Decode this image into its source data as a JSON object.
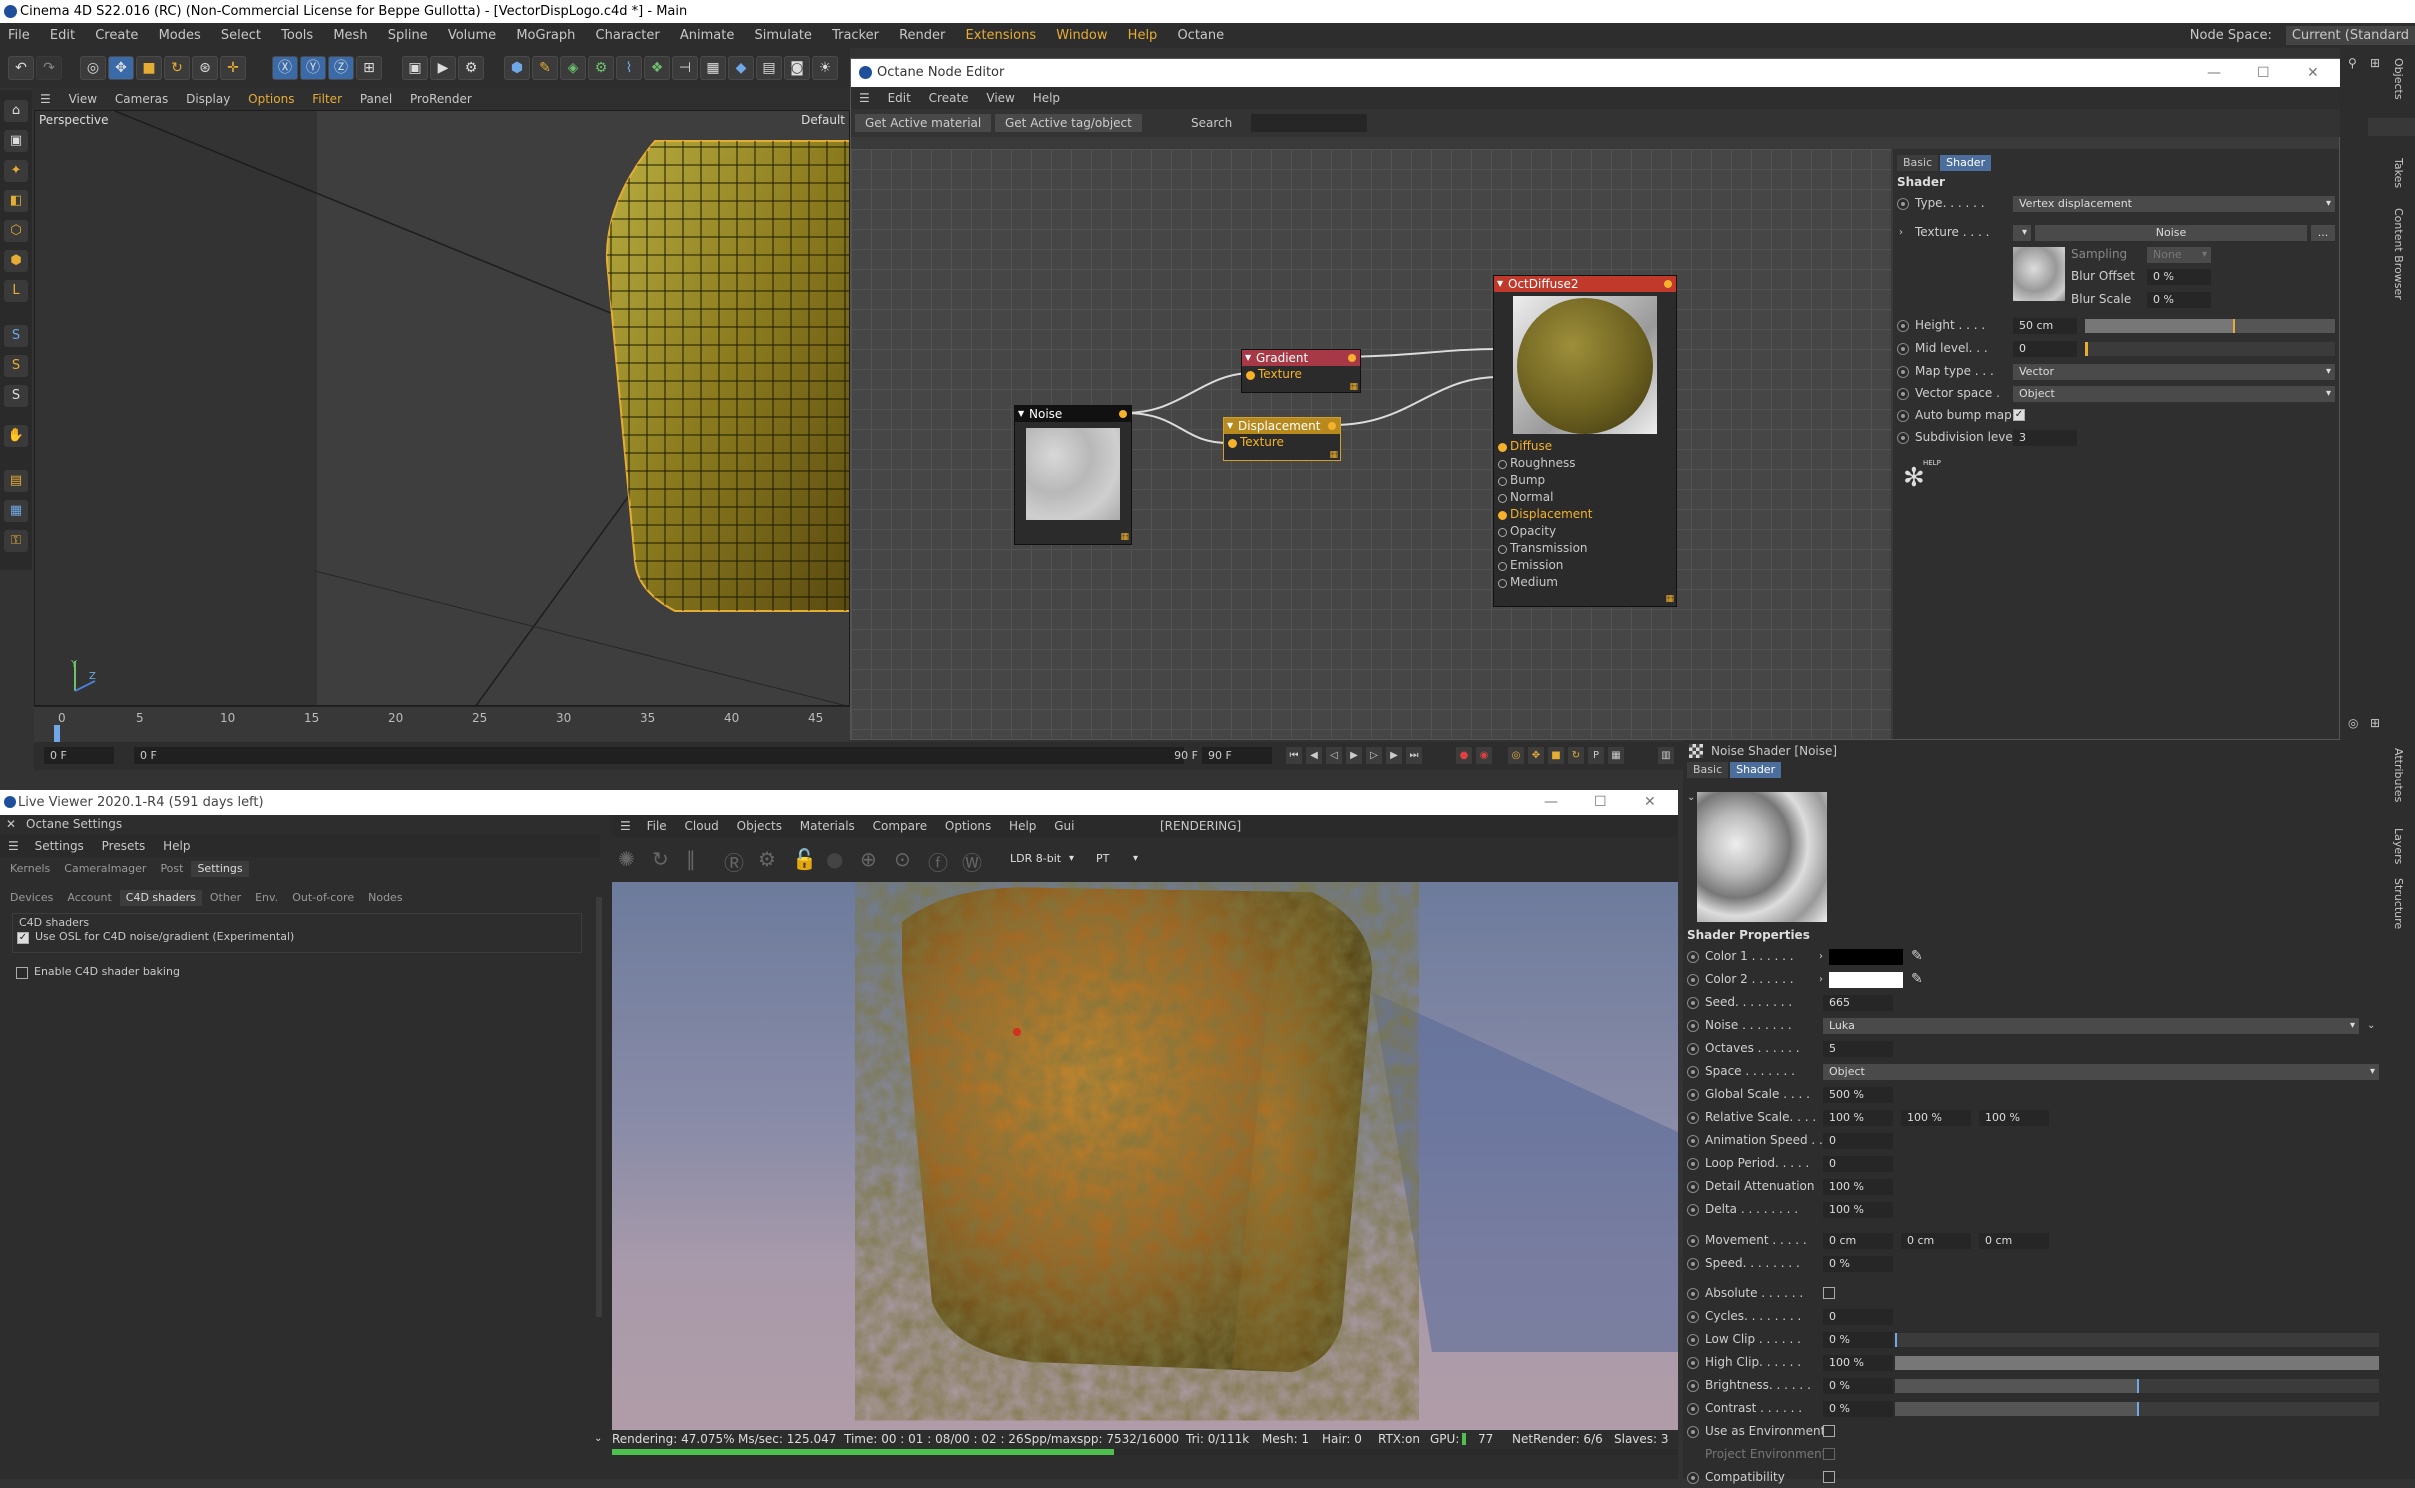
{
  "window": {
    "title": "Cinema 4D S22.016 (RC) (Non-Commercial License for Beppe Gullotta) - [VectorDispLogo.c4d *] - Main"
  },
  "menubar": {
    "items": [
      "File",
      "Edit",
      "Create",
      "Modes",
      "Select",
      "Tools",
      "Mesh",
      "Spline",
      "Volume",
      "MoGraph",
      "Character",
      "Animate",
      "Simulate",
      "Tracker",
      "Render",
      "Extensions",
      "Window",
      "Help",
      "Octane"
    ],
    "node_space_label": "Node Space:",
    "node_space_value": "Current (Standard"
  },
  "viewport": {
    "menu": [
      "View",
      "Cameras",
      "Display",
      "Options",
      "Filter",
      "Panel",
      "ProRender"
    ],
    "camera_label": "Perspective",
    "camera_name": "Default",
    "axis_labels": [
      "Y",
      "Z"
    ]
  },
  "timeline": {
    "ticks": [
      "0",
      "5",
      "10",
      "15",
      "20",
      "25",
      "30",
      "35",
      "40",
      "45"
    ],
    "start_frame": "0 F",
    "current_frame": "0 F",
    "end_frame": "90 F",
    "end_frame2": "90 F"
  },
  "node_editor": {
    "title": "Octane Node Editor",
    "menu": [
      "Edit",
      "Create",
      "View",
      "Help"
    ],
    "get_active_material": "Get Active material",
    "get_active_tag": "Get Active tag/object",
    "search_label": "Search",
    "search_value": "",
    "nodes": {
      "diffuse": {
        "title": "OctDiffuse2",
        "pins": [
          "Diffuse",
          "Roughness",
          "Bump",
          "Normal",
          "Displacement",
          "Opacity",
          "Transmission",
          "Emission",
          "Medium"
        ]
      },
      "gradient": {
        "title": "Gradient",
        "pin": "Texture"
      },
      "noise": {
        "title": "Noise"
      },
      "displacement": {
        "title": "Displacement",
        "pin": "Texture"
      }
    },
    "props": {
      "tabs": [
        "Basic",
        "Shader"
      ],
      "section": "Shader",
      "type_label": "Type. . . . . .",
      "type_value": "Vertex displacement",
      "texture_label": "Texture . . . .",
      "texture_value": "Noise",
      "texture_more": "...",
      "sampling_label": "Sampling",
      "sampling_value": "None",
      "blur_offset_label": "Blur Offset",
      "blur_offset_value": "0 %",
      "blur_scale_label": "Blur Scale",
      "blur_scale_value": "0 %",
      "height_label": "Height . . . .",
      "height_value": "50 cm",
      "height_fraction": 0.6,
      "mid_level_label": "Mid level. . .",
      "mid_level_value": "0",
      "map_type_label": "Map type . . .",
      "map_type_value": "Vector",
      "vector_space_label": "Vector space .",
      "vector_space_value": "Object",
      "auto_bump_label": "Auto bump map",
      "subdivision_label": "Subdivision level",
      "subdivision_value": "3",
      "help_label": "HELP"
    }
  },
  "live_viewer": {
    "title": "Live Viewer 2020.1-R4 (591 days left)",
    "settings_title": "Octane Settings",
    "left_menu": [
      "Settings",
      "Presets",
      "Help"
    ],
    "tabs1": [
      "Kernels",
      "CameraImager",
      "Post",
      "Settings"
    ],
    "tabs2": [
      "Devices",
      "Account",
      "C4D shaders",
      "Other",
      "Env.",
      "Out-of-core",
      "Nodes"
    ],
    "group_label": "C4D shaders",
    "osl_label": "Use OSL for C4D noise/gradient (Experimental)",
    "bake_label": "Enable C4D shader baking",
    "menu": [
      "File",
      "Cloud",
      "Objects",
      "Materials",
      "Compare",
      "Options",
      "Help",
      "Gui"
    ],
    "rendering_tag": "[RENDERING]",
    "ldr_value": "LDR 8-bit",
    "pt_value": "PT",
    "status": {
      "rendering": "Rendering: 47.075%",
      "ms": "Ms/sec: 125.047",
      "time": "Time: 00 : 01 : 08/00 : 02 : 26",
      "spp": "Spp/maxspp: 7532/16000",
      "tri": "Tri: 0/111k",
      "mesh": "Mesh: 1",
      "hair": "Hair: 0",
      "rtx": "RTX:on",
      "gpu_label": "GPU:",
      "gpu_temp": "77",
      "netrender": "NetRender: 6/6",
      "slaves": "Slaves: 3"
    },
    "progress": 0.47075
  },
  "attributes": {
    "title": "Noise Shader [Noise]",
    "tabs": [
      "Basic",
      "Shader"
    ],
    "section": "Shader Properties",
    "rows": [
      {
        "label": "Color 1 . . . . . .",
        "value": ""
      },
      {
        "label": "Color 2 . . . . . .",
        "value": ""
      },
      {
        "label": "Seed. . . . . . . .",
        "value": "665"
      },
      {
        "label": "Noise . . . . . . .",
        "value": "Luka"
      },
      {
        "label": "Octaves . . . . . .",
        "value": "5"
      },
      {
        "label": "Space . . . . . . .",
        "value": "Object"
      },
      {
        "label": "Global Scale . . . .",
        "value": "500 %"
      },
      {
        "label": "Relative Scale. . . .",
        "value": "100 %",
        "value2": "100 %",
        "value3": "100 %"
      },
      {
        "label": "Animation Speed . .",
        "value": "0"
      },
      {
        "label": "Loop Period. . . . .",
        "value": "0"
      },
      {
        "label": "Detail Attenuation",
        "value": "100 %"
      },
      {
        "label": "Delta . . . . . . . .",
        "value": "100 %"
      },
      {
        "label": "Movement . . . . .",
        "value": "0 cm",
        "value2": "0 cm",
        "value3": "0 cm"
      },
      {
        "label": "Speed. . . . . . . .",
        "value": "0 %"
      },
      {
        "label": "Absolute . . . . . .",
        "value": ""
      },
      {
        "label": "Cycles. . . . . . . .",
        "value": "0"
      },
      {
        "label": "Low Clip . . . . . .",
        "value": "0 %"
      },
      {
        "label": "High Clip. . . . . .",
        "value": "100 %"
      },
      {
        "label": "Brightness. . . . . .",
        "value": "0 %"
      },
      {
        "label": "Contrast . . . . . .",
        "value": "0 %"
      },
      {
        "label": "Use as Environment",
        "value": ""
      },
      {
        "label": "Project Environment",
        "value": ""
      },
      {
        "label": "Compatibility",
        "value": ""
      }
    ]
  },
  "right_strip": {
    "tabs": [
      "Objects",
      "Takes",
      "Content Browser",
      "Attributes",
      "Layers",
      "Structure"
    ]
  },
  "colors": {
    "accent": "#e6ad34",
    "node_orange": "#f5b22a",
    "diffuse_header": "#c0392b",
    "gradient_header": "#a73845",
    "displacement_header": "#b88a1e",
    "selected_tab": "#4c6e9c",
    "progress_green": "#4dc04d"
  }
}
